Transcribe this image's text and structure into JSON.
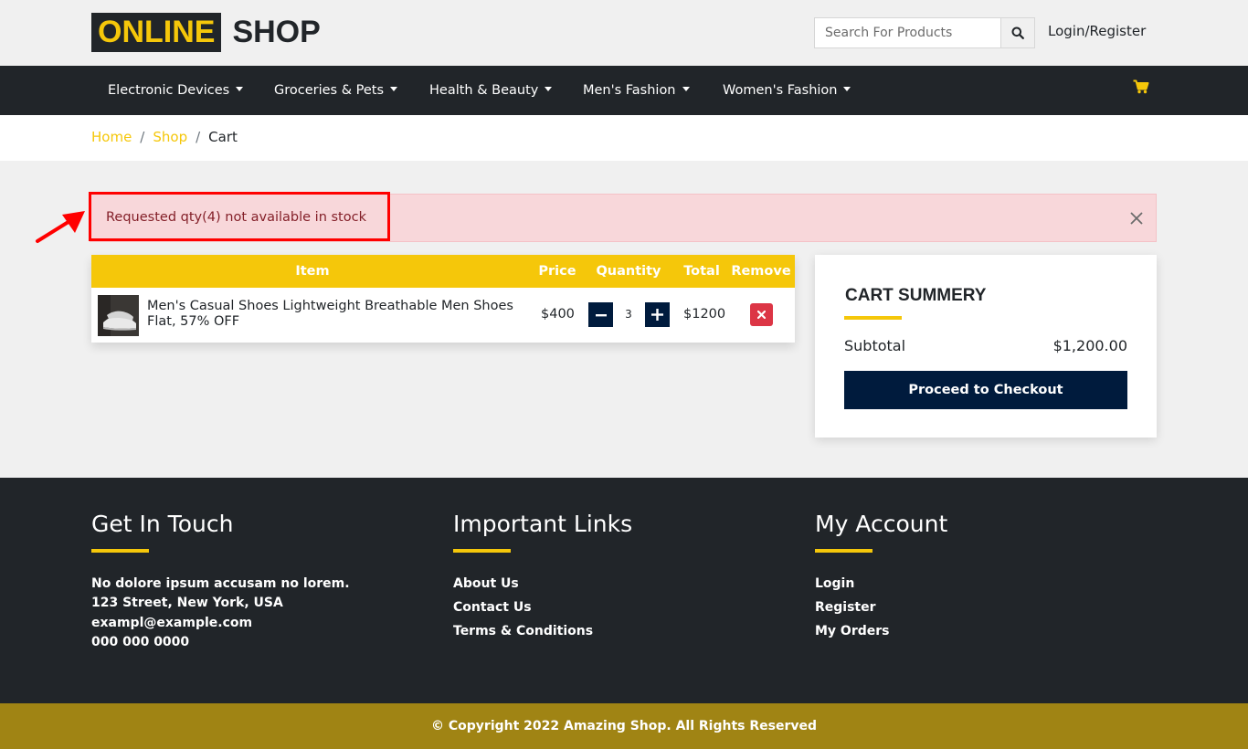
{
  "header": {
    "logo_primary": "ONLINE",
    "logo_secondary": "SHOP",
    "search_placeholder": "Search For Products",
    "login_label": "Login/Register"
  },
  "nav": {
    "items": [
      {
        "label": "Electronic Devices"
      },
      {
        "label": "Groceries & Pets"
      },
      {
        "label": "Health & Beauty"
      },
      {
        "label": "Men's Fashion"
      },
      {
        "label": "Women's Fashion"
      }
    ],
    "cart_icon": "shopping-cart-icon"
  },
  "breadcrumb": {
    "items": [
      "Home",
      "Shop"
    ],
    "current": "Cart"
  },
  "alert": {
    "message": "Requested qty(4) not available in stock"
  },
  "cart_table": {
    "headers": {
      "item": "Item",
      "price": "Price",
      "quantity": "Quantity",
      "total": "Total",
      "remove": "Remove"
    },
    "rows": [
      {
        "name": "Men's Casual Shoes Lightweight Breathable Men Shoes Flat, 57% OFF",
        "price": "$400",
        "qty": "3",
        "total": "$1200"
      }
    ]
  },
  "summary": {
    "title": "CART SUMMERY",
    "subtotal_label": "Subtotal",
    "subtotal_value": "$1,200.00",
    "checkout_label": "Proceed to Checkout"
  },
  "footer": {
    "touch": {
      "title": "Get In Touch",
      "lines": [
        "No dolore ipsum accusam no lorem.",
        "123 Street, New York, USA",
        "exampl@example.com",
        "000 000 0000"
      ]
    },
    "links": {
      "title": "Important Links",
      "items": [
        "About Us",
        "Contact Us",
        "Terms & Conditions"
      ]
    },
    "account": {
      "title": "My Account",
      "items": [
        "Login",
        "Register",
        "My Orders"
      ]
    },
    "copyright": "© Copyright 2022 Amazing Shop. All Rights Reserved"
  },
  "colors": {
    "accent": "#f5c70a",
    "dark": "#212529",
    "navy": "#001b3d",
    "danger": "#dc3545",
    "alert_bg": "#f8d7da",
    "alert_text": "#842029",
    "footer_bar": "#a08414",
    "annotation": "#ff0000"
  }
}
